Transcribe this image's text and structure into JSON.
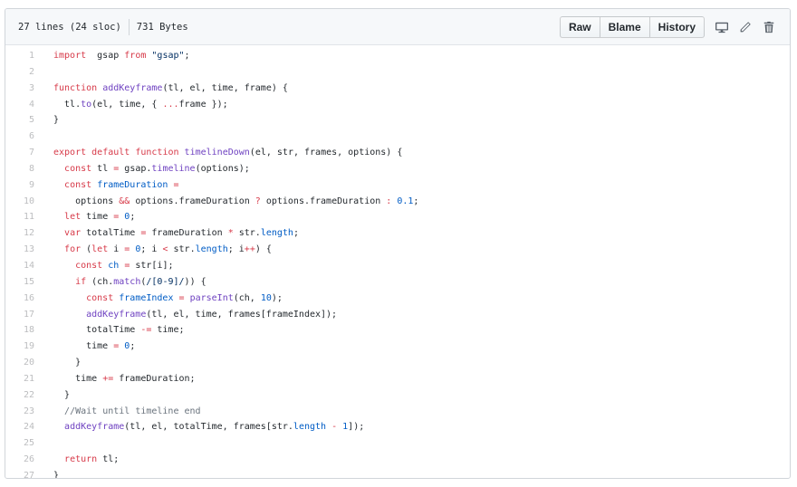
{
  "file_info": {
    "lines": "27 lines (24 sloc)",
    "size": "731 Bytes"
  },
  "actions": {
    "raw": "Raw",
    "blame": "Blame",
    "history": "History"
  },
  "icons": {
    "desktop": "desktop-icon",
    "edit": "pencil-icon",
    "delete": "trash-icon"
  },
  "colors": {
    "keyword": "#d73a49",
    "function": "#6f42c1",
    "string": "#032f62",
    "number": "#005cc5",
    "comment": "#6a737d"
  },
  "code": {
    "lines": [
      [
        [
          "k",
          "import"
        ],
        [
          "",
          "  gsap "
        ],
        [
          "k",
          "from"
        ],
        [
          "",
          " "
        ],
        [
          "s",
          "\"gsap\""
        ],
        [
          "",
          ";"
        ]
      ],
      [],
      [
        [
          "k",
          "function"
        ],
        [
          "",
          " "
        ],
        [
          "f",
          "addKeyframe"
        ],
        [
          "",
          "(tl, el, time, frame) {"
        ]
      ],
      [
        [
          "",
          "  tl."
        ],
        [
          "f",
          "to"
        ],
        [
          "",
          "(el, time, { "
        ],
        [
          "k",
          "..."
        ],
        [
          "",
          "frame });"
        ]
      ],
      [
        [
          "",
          "}"
        ]
      ],
      [],
      [
        [
          "k",
          "export"
        ],
        [
          "",
          " "
        ],
        [
          "k",
          "default"
        ],
        [
          "",
          " "
        ],
        [
          "k",
          "function"
        ],
        [
          "",
          " "
        ],
        [
          "f",
          "timelineDown"
        ],
        [
          "",
          "(el, str, frames, options) {"
        ]
      ],
      [
        [
          "",
          "  "
        ],
        [
          "k",
          "const"
        ],
        [
          "",
          " tl "
        ],
        [
          "k",
          "="
        ],
        [
          "",
          " gsap."
        ],
        [
          "f",
          "timeline"
        ],
        [
          "",
          "(options);"
        ]
      ],
      [
        [
          "",
          "  "
        ],
        [
          "k",
          "const"
        ],
        [
          "",
          " "
        ],
        [
          "n",
          "frameDuration"
        ],
        [
          "",
          " "
        ],
        [
          "k",
          "="
        ]
      ],
      [
        [
          "",
          "    options "
        ],
        [
          "k",
          "&&"
        ],
        [
          "",
          " options.frameDuration "
        ],
        [
          "k",
          "?"
        ],
        [
          "",
          " options.frameDuration "
        ],
        [
          "k",
          ":"
        ],
        [
          "",
          " "
        ],
        [
          "n",
          "0.1"
        ],
        [
          "",
          ";"
        ]
      ],
      [
        [
          "",
          "  "
        ],
        [
          "k",
          "let"
        ],
        [
          "",
          " time "
        ],
        [
          "k",
          "="
        ],
        [
          "",
          " "
        ],
        [
          "n",
          "0"
        ],
        [
          "",
          ";"
        ]
      ],
      [
        [
          "",
          "  "
        ],
        [
          "k",
          "var"
        ],
        [
          "",
          " totalTime "
        ],
        [
          "k",
          "="
        ],
        [
          "",
          " frameDuration "
        ],
        [
          "k",
          "*"
        ],
        [
          "",
          " str."
        ],
        [
          "n",
          "length"
        ],
        [
          "",
          ";"
        ]
      ],
      [
        [
          "",
          "  "
        ],
        [
          "k",
          "for"
        ],
        [
          "",
          " ("
        ],
        [
          "k",
          "let"
        ],
        [
          "",
          " i "
        ],
        [
          "k",
          "="
        ],
        [
          "",
          " "
        ],
        [
          "n",
          "0"
        ],
        [
          "",
          "; i "
        ],
        [
          "k",
          "<"
        ],
        [
          "",
          " str."
        ],
        [
          "n",
          "length"
        ],
        [
          "",
          "; i"
        ],
        [
          "k",
          "++"
        ],
        [
          "",
          ") {"
        ]
      ],
      [
        [
          "",
          "    "
        ],
        [
          "k",
          "const"
        ],
        [
          "",
          " "
        ],
        [
          "n",
          "ch"
        ],
        [
          "",
          " "
        ],
        [
          "k",
          "="
        ],
        [
          "",
          " str[i];"
        ]
      ],
      [
        [
          "",
          "    "
        ],
        [
          "k",
          "if"
        ],
        [
          "",
          " (ch."
        ],
        [
          "f",
          "match"
        ],
        [
          "",
          "("
        ],
        [
          "s",
          "/[0-9]/"
        ],
        [
          "",
          ")) {"
        ]
      ],
      [
        [
          "",
          "      "
        ],
        [
          "k",
          "const"
        ],
        [
          "",
          " "
        ],
        [
          "n",
          "frameIndex"
        ],
        [
          "",
          " "
        ],
        [
          "k",
          "="
        ],
        [
          "",
          " "
        ],
        [
          "f",
          "parseInt"
        ],
        [
          "",
          "(ch, "
        ],
        [
          "n",
          "10"
        ],
        [
          "",
          ");"
        ]
      ],
      [
        [
          "",
          "      "
        ],
        [
          "f",
          "addKeyframe"
        ],
        [
          "",
          "(tl, el, time, frames[frameIndex]);"
        ]
      ],
      [
        [
          "",
          "      totalTime "
        ],
        [
          "k",
          "-="
        ],
        [
          "",
          " time;"
        ]
      ],
      [
        [
          "",
          "      time "
        ],
        [
          "k",
          "="
        ],
        [
          "",
          " "
        ],
        [
          "n",
          "0"
        ],
        [
          "",
          ";"
        ]
      ],
      [
        [
          "",
          "    }"
        ]
      ],
      [
        [
          "",
          "    time "
        ],
        [
          "k",
          "+="
        ],
        [
          "",
          " frameDuration;"
        ]
      ],
      [
        [
          "",
          "  }"
        ]
      ],
      [
        [
          "",
          "  "
        ],
        [
          "c",
          "//Wait until timeline end"
        ]
      ],
      [
        [
          "",
          "  "
        ],
        [
          "f",
          "addKeyframe"
        ],
        [
          "",
          "(tl, el, totalTime, frames[str."
        ],
        [
          "n",
          "length"
        ],
        [
          "",
          " "
        ],
        [
          "k",
          "-"
        ],
        [
          "",
          " "
        ],
        [
          "n",
          "1"
        ],
        [
          "",
          "]);"
        ]
      ],
      [],
      [
        [
          "",
          "  "
        ],
        [
          "k",
          "return"
        ],
        [
          "",
          " tl;"
        ]
      ],
      [
        [
          "",
          "}"
        ]
      ]
    ]
  }
}
